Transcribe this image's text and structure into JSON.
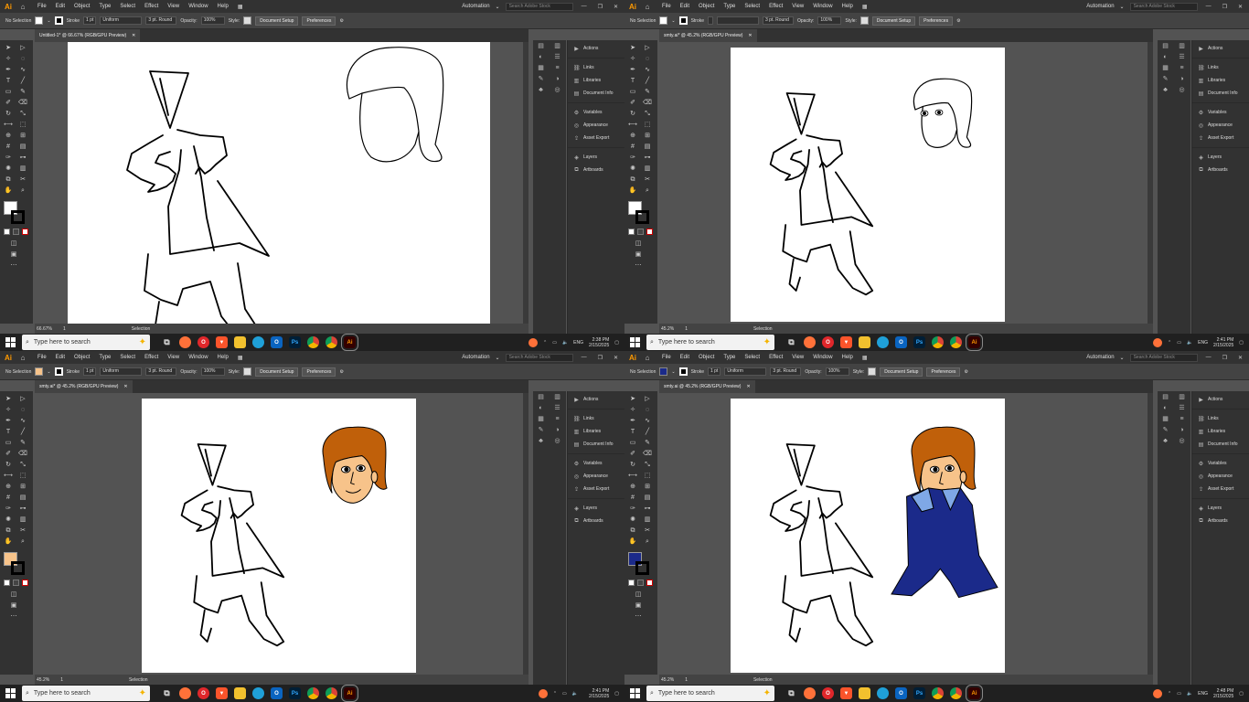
{
  "quadrants": [
    {
      "menu": [
        "File",
        "Edit",
        "Object",
        "Type",
        "Select",
        "Effect",
        "View",
        "Window",
        "Help"
      ],
      "workspace": "Automation",
      "search_placeholder": "Search Adobe Stock",
      "selection_label": "No Selection",
      "fill_color": "#ffffff",
      "stroke_label": "Stroke",
      "stroke_weight": "1 pt",
      "profile": "Uniform",
      "brush": "3 pt. Round",
      "opacity_label": "Opacity:",
      "opacity": "100%",
      "style_label": "Style:",
      "doc_setup": "Document Setup",
      "preferences": "Preferences",
      "tab_title": "Untitled-1* @ 66.67% (RGB/GPU Preview)",
      "zoom": "66.67%",
      "artboard_num": "1",
      "status_tool": "Selection",
      "panels": [
        "Actions",
        "Links",
        "Libraries",
        "Document Info",
        "Variables",
        "Appearance",
        "Asset Export",
        "Layers",
        "Artboards"
      ],
      "time": "2:38 PM",
      "date": "2/15/2025",
      "taskbar_search": "Type here to search",
      "lang": "ENG"
    },
    {
      "menu": [
        "File",
        "Edit",
        "Object",
        "Type",
        "Select",
        "Effect",
        "View",
        "Window",
        "Help"
      ],
      "workspace": "Automation",
      "search_placeholder": "Search Adobe Stock",
      "selection_label": "No Selection",
      "fill_color": "#ffffff",
      "stroke_label": "Stroke",
      "stroke_weight": "",
      "profile": "",
      "brush": "3 pt. Round",
      "opacity_label": "Opacity:",
      "opacity": "100%",
      "style_label": "Style:",
      "doc_setup": "Document Setup",
      "preferences": "Preferences",
      "tab_title": "smty.ai* @ 45.2% (RGB/GPU Preview)",
      "zoom": "45.2%",
      "artboard_num": "1",
      "status_tool": "Selection",
      "panels": [
        "Actions",
        "Links",
        "Libraries",
        "Document Info",
        "Variables",
        "Appearance",
        "Asset Export",
        "Layers",
        "Artboards"
      ],
      "time": "2:41 PM",
      "date": "2/15/2025",
      "taskbar_search": "Type here to search",
      "lang": "ENG"
    },
    {
      "menu": [
        "File",
        "Edit",
        "Object",
        "Type",
        "Select",
        "Effect",
        "View",
        "Window",
        "Help"
      ],
      "workspace": "Automation",
      "search_placeholder": "Search Adobe Stock",
      "selection_label": "No Selection",
      "fill_color": "#f7c38a",
      "stroke_label": "Stroke",
      "stroke_weight": "1 pt",
      "profile": "Uniform",
      "brush": "3 pt. Round",
      "opacity_label": "Opacity:",
      "opacity": "100%",
      "style_label": "Style:",
      "doc_setup": "Document Setup",
      "preferences": "Preferences",
      "tab_title": "smty.ai* @ 45.2% (RGB/GPU Preview)",
      "zoom": "45.2%",
      "artboard_num": "1",
      "status_tool": "Selection",
      "panels": [
        "Actions",
        "Links",
        "Libraries",
        "Document Info",
        "Variables",
        "Appearance",
        "Asset Export",
        "Layers",
        "Artboards"
      ],
      "time": "2:41 PM",
      "date": "2/15/2025",
      "taskbar_search": "Type here to search",
      "lang": ""
    },
    {
      "menu": [
        "File",
        "Edit",
        "Object",
        "Type",
        "Select",
        "Effect",
        "View",
        "Window",
        "Help"
      ],
      "workspace": "Automation",
      "search_placeholder": "Search Adobe Stock",
      "selection_label": "No Selection",
      "fill_color": "#1b2a8a",
      "stroke_label": "Stroke",
      "stroke_weight": "1 pt",
      "profile": "Uniform",
      "brush": "3 pt. Round",
      "opacity_label": "Opacity:",
      "opacity": "100%",
      "style_label": "Style:",
      "doc_setup": "Document Setup",
      "preferences": "Preferences",
      "tab_title": "smty.ai @ 45.2% (RGB/GPU Preview)",
      "zoom": "45.2%",
      "artboard_num": "1",
      "status_tool": "Selection",
      "panels": [
        "Actions",
        "Links",
        "Libraries",
        "Document Info",
        "Variables",
        "Appearance",
        "Asset Export",
        "Layers",
        "Artboards"
      ],
      "time": "2:48 PM",
      "date": "2/15/2025",
      "taskbar_search": "Type here to search",
      "lang": "ENG"
    }
  ],
  "app_logo": "Ai",
  "taskbar_apps": [
    {
      "icon": "task-view-icon",
      "label": ""
    },
    {
      "icon": "firefox-icon",
      "label": ""
    },
    {
      "icon": "opera-icon",
      "label": ""
    },
    {
      "icon": "brave-icon",
      "label": ""
    },
    {
      "icon": "file-explorer-icon",
      "label": ""
    },
    {
      "icon": "edge-icon",
      "label": ""
    },
    {
      "icon": "outlook-icon",
      "label": ""
    },
    {
      "icon": "photoshop-icon",
      "label": "Ps"
    },
    {
      "icon": "chrome-icon",
      "label": ""
    },
    {
      "icon": "chrome-alt-icon",
      "label": ""
    },
    {
      "icon": "illustrator-icon",
      "label": "Ai"
    }
  ],
  "colors": {
    "hair": "#c0600a",
    "skin": "#f7c38a",
    "jacket": "#1b2a8a",
    "collar": "#7fa8e6",
    "accent": "#ff9a00"
  }
}
